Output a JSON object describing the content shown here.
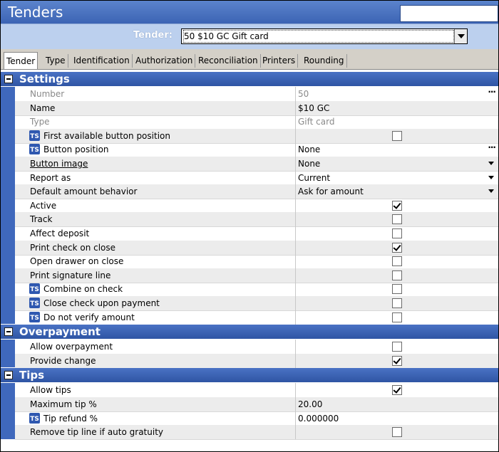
{
  "window": {
    "title": "Tenders"
  },
  "tender": {
    "label": "Tender:",
    "value": "50 $10 GC Gift card"
  },
  "tabs": [
    "Tender",
    "Type",
    "Identification",
    "Authorization",
    "Reconciliation",
    "Printers",
    "Rounding"
  ],
  "sections": [
    {
      "title": "Settings",
      "rows": [
        {
          "name": "Number",
          "value": "50",
          "control": "text",
          "disabled": true,
          "ts": false,
          "ellipsis": true
        },
        {
          "name": "Name",
          "value": "$10 GC",
          "control": "text",
          "ts": false
        },
        {
          "name": "Type",
          "value": "Gift card",
          "control": "text",
          "disabled": true,
          "ts": false
        },
        {
          "name": "First available button position",
          "control": "checkbox",
          "checked": false,
          "ts": true
        },
        {
          "name": "Button position",
          "value": "None",
          "control": "text",
          "ts": true,
          "ellipsis": true
        },
        {
          "name": "Button image",
          "value": "None",
          "control": "dropdown",
          "ts": false,
          "underline": true
        },
        {
          "name": "Report as",
          "value": "Current",
          "control": "dropdown",
          "ts": false
        },
        {
          "name": "Default amount behavior",
          "value": "Ask for amount",
          "control": "dropdown",
          "ts": false
        },
        {
          "name": "Active",
          "control": "checkbox",
          "checked": true,
          "ts": false
        },
        {
          "name": "Track",
          "control": "checkbox",
          "checked": false,
          "ts": false
        },
        {
          "name": "Affect deposit",
          "control": "checkbox",
          "checked": false,
          "ts": false
        },
        {
          "name": "Print check on close",
          "control": "checkbox",
          "checked": true,
          "ts": false
        },
        {
          "name": "Open drawer on close",
          "control": "checkbox",
          "checked": false,
          "ts": false
        },
        {
          "name": "Print signature line",
          "control": "checkbox",
          "checked": false,
          "ts": false
        },
        {
          "name": "Combine on check",
          "control": "checkbox",
          "checked": false,
          "ts": true
        },
        {
          "name": "Close check upon payment",
          "control": "checkbox",
          "checked": false,
          "ts": true
        },
        {
          "name": "Do not verify amount",
          "control": "checkbox",
          "checked": false,
          "ts": true
        }
      ]
    },
    {
      "title": "Overpayment",
      "rows": [
        {
          "name": "Allow overpayment",
          "control": "checkbox",
          "checked": false,
          "ts": false
        },
        {
          "name": "Provide change",
          "control": "checkbox",
          "checked": true,
          "ts": false
        }
      ]
    },
    {
      "title": "Tips",
      "rows": [
        {
          "name": "Allow tips",
          "control": "checkbox",
          "checked": true,
          "ts": false
        },
        {
          "name": "Maximum tip %",
          "value": "20.00",
          "control": "text",
          "ts": false
        },
        {
          "name": "Tip refund %",
          "value": "0.000000",
          "control": "text",
          "ts": true
        },
        {
          "name": "Remove tip line if auto gratuity",
          "control": "checkbox",
          "checked": false,
          "ts": false
        }
      ]
    }
  ],
  "icons": {
    "ts_badge": "ts-icon",
    "ellipsis": "ellipsis-button",
    "dropdown": "dropdown-arrow"
  },
  "colors": {
    "title_bar": "#3c64b4",
    "section_bar": "#3a62b4",
    "tender_bar": "#bcd0ee"
  }
}
